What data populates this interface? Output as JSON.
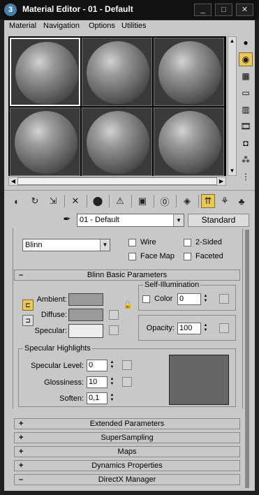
{
  "window": {
    "title": "Material Editor - 01 - Default",
    "app_icon": "3",
    "buttons": [
      "_",
      "□",
      "✕"
    ]
  },
  "menu": [
    "Material",
    "Navigation",
    "Options",
    "Utilities"
  ],
  "sample_slots": {
    "rows": 2,
    "cols": 3,
    "active_index": 0
  },
  "material": {
    "name": "01 - Default",
    "type": "Standard"
  },
  "shader": {
    "value": "Blinn",
    "options": {
      "wire": "Wire",
      "two_sided": "2-Sided",
      "face_map": "Face Map",
      "faceted": "Faceted"
    }
  },
  "basic_params": {
    "title": "Blinn Basic Parameters",
    "sign": "–",
    "ambient": "Ambient:",
    "diffuse": "Diffuse:",
    "specular": "Specular:",
    "self_illum": {
      "title": "Self-Illumination",
      "color_label": "Color",
      "value": "0"
    },
    "opacity": {
      "label": "Opacity:",
      "value": "100"
    },
    "colors": {
      "ambient": "#9a9a9a",
      "diffuse": "#9a9a9a",
      "specular": "#ededed",
      "highlight": "#666666"
    }
  },
  "specular_highlights": {
    "title": "Specular Highlights",
    "level_label": "Specular Level:",
    "level": "0",
    "gloss_label": "Glossiness:",
    "gloss": "10",
    "soften_label": "Soften:",
    "soften": "0,1"
  },
  "rollouts": [
    {
      "sign": "+",
      "label": "Extended Parameters"
    },
    {
      "sign": "+",
      "label": "SuperSampling"
    },
    {
      "sign": "+",
      "label": "Maps"
    },
    {
      "sign": "+",
      "label": "Dynamics Properties"
    },
    {
      "sign": "–",
      "label": "DirectX Manager"
    }
  ]
}
